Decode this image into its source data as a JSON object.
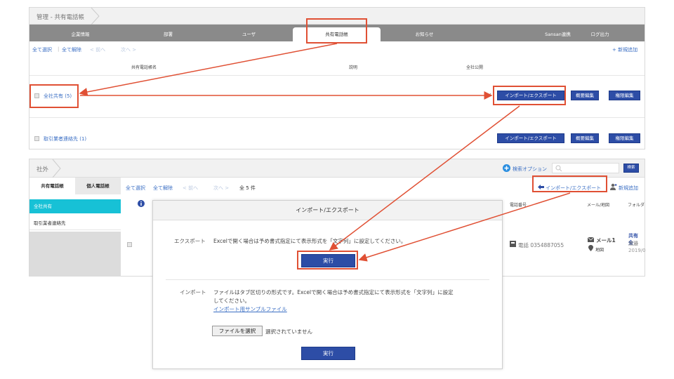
{
  "top": {
    "breadcrumb": "管理 - 共有電話帳",
    "tabs": [
      "企業情報",
      "部署",
      "ユーザ",
      "共有電話帳",
      "お知らせ",
      "Sansan連携",
      "ログ出力"
    ],
    "toolbar": {
      "select_all": "全て選択",
      "clear_all": "全て解除",
      "prev": "< 前へ",
      "next": "次へ >",
      "new_add": "+ 新規追加"
    },
    "columns": [
      "共有電話帳名",
      "説明",
      "全社公開"
    ],
    "rows": [
      {
        "name": "全社共有 (5)",
        "check": "✓",
        "import_export": "インポート/エクスポート",
        "edit_summary": "概要編集",
        "edit_permission": "権限編集"
      },
      {
        "name": "取引業者連絡先 (1)",
        "check": "",
        "import_export": "インポート/エクスポート",
        "edit_summary": "概要編集",
        "edit_permission": "権限編集"
      }
    ]
  },
  "bottom": {
    "breadcrumb": "社外",
    "search_option": "検索オプション",
    "search_button": "検索",
    "tabs": [
      "共有電話帳",
      "個人電話帳"
    ],
    "sidebar_items": [
      "全社共有",
      "取引業者連絡先"
    ],
    "toolbar": {
      "select_all": "全て選択",
      "clear_all": "全て解除",
      "prev": "< 前へ",
      "next": "次へ >",
      "count": "全 5 件",
      "import_export": "インポート/エクスポート",
      "new_add": "新規追加"
    },
    "columns": [
      "電話番号",
      "メール/地図",
      "フォルダ"
    ],
    "contact": {
      "phone": "電話 0354887055",
      "mail": "メール1",
      "map": "地図",
      "folder": "共有 全",
      "folder2": "渡邉",
      "date": "2019/0"
    }
  },
  "modal": {
    "title": "インポート/エクスポート",
    "export_label": "エクスポート",
    "export_text": "Excelで開く場合は予め書式指定にて表示形式を「文字列」に設定してください。",
    "export_button": "実行",
    "import_label": "インポート",
    "import_text_1": "ファイルはタブ区切りの形式です。Excelで開く場合は予め書式指定にて表示形式を「文字列」に設定",
    "import_text_2": "してください。",
    "sample_link": "インポート用サンプルファイル",
    "file_button": "ファイルを選択",
    "file_status": "選択されていません",
    "import_button": "実行"
  },
  "colors": {
    "accent_blue": "#2d4da6",
    "link_blue": "#3b6fc4",
    "highlight_red": "#e05034",
    "sidebar_active": "#17c1d6",
    "tab_bar": "#8a8a8a"
  }
}
